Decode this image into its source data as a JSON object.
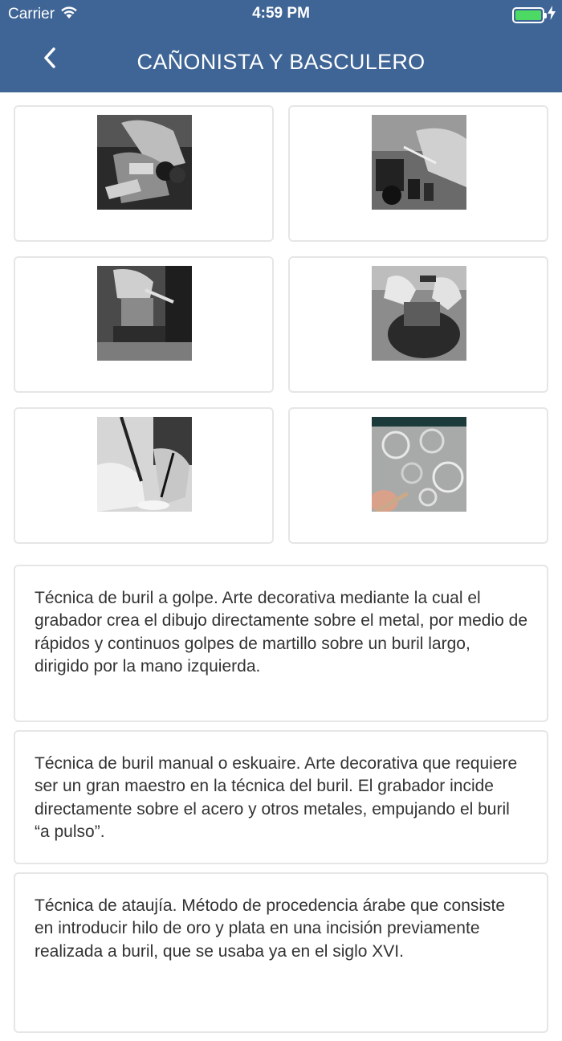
{
  "status_bar": {
    "carrier": "Carrier",
    "time": "4:59 PM",
    "wifi_icon": "wifi-icon",
    "battery_icon": "battery-charging-icon"
  },
  "nav": {
    "title": "CAÑONISTA Y BASCULERO",
    "back_icon": "chevron-left-icon"
  },
  "colors": {
    "header_bg": "#3f6596",
    "battery_fill": "#4cd964",
    "card_border": "#e6e6e6",
    "text": "#333333"
  },
  "gallery": {
    "images": [
      {
        "name": "craftsman-vise-photo"
      },
      {
        "name": "engraving-tools-photo"
      },
      {
        "name": "gun-mechanism-vise-photo"
      },
      {
        "name": "hammer-chisel-engraving-photo"
      },
      {
        "name": "hand-burin-photo"
      },
      {
        "name": "engraved-metal-plate-photo"
      }
    ]
  },
  "descriptions": [
    "Técnica de buril a golpe. Arte decorativa mediante la cual el grabador crea el dibujo directamente sobre el metal, por medio de rápidos y continuos golpes de martillo sobre un buril largo, dirigido por la mano izquierda.",
    "Técnica de buril manual o eskuaire. Arte decorativa que requiere ser un gran maestro en la técnica del buril. El grabador incide directamente sobre el acero y otros metales, empujando el buril “a pulso”.",
    "Técnica de ataujía. Método de procedencia árabe que consiste en introducir hilo de oro y plata en una incisión previamente realizada a buril, que se usaba ya en el siglo XVI."
  ]
}
